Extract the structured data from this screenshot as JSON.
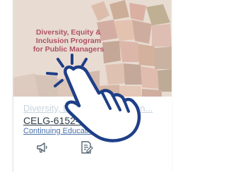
{
  "card": {
    "hero_title_lines": [
      "Diversity, Equity &",
      "Inclusion Program",
      "for Public Managers"
    ],
    "course_name": "Diversity, Equity and Inclusion...",
    "course_code": "CELG-6152-SP21-May 5",
    "term": "Continuing Education",
    "actions": {
      "announcements_icon": "megaphone-icon",
      "assignments_icon": "assignment-icon"
    }
  },
  "overlay": {
    "gesture_icon": "tap-hand-icon"
  },
  "colors": {
    "hero_text": "#a43a4f",
    "code_text": "#2d3b45",
    "term_link": "#4a73a8",
    "hand_stroke": "#1f3f88"
  }
}
